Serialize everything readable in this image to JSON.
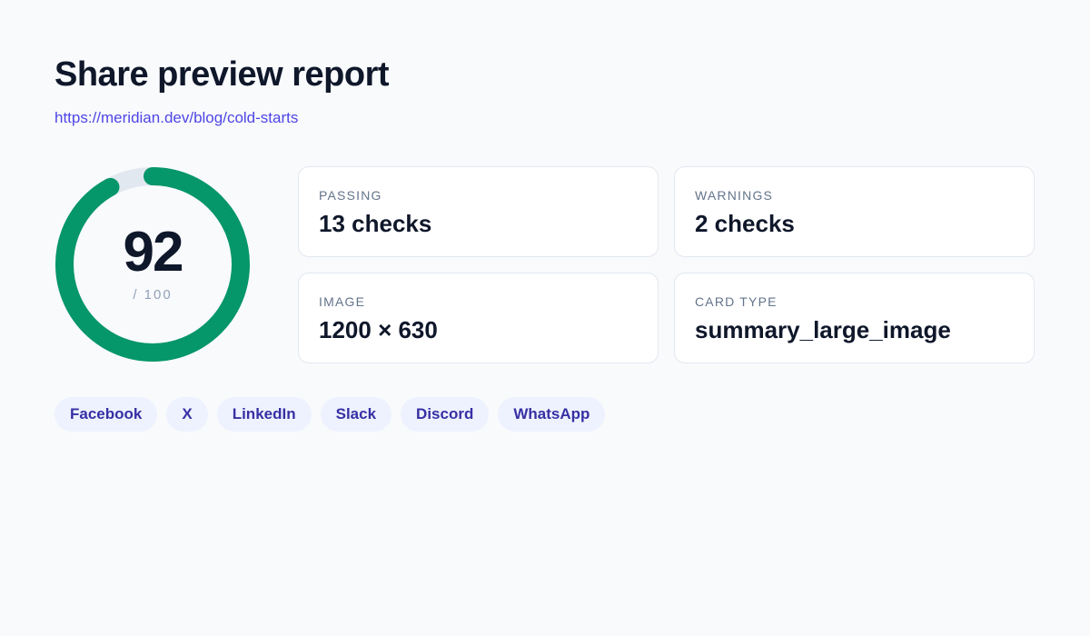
{
  "header": {
    "title": "Share preview report",
    "url": "https://meridian.dev/blog/cold-starts"
  },
  "score": {
    "value": "92",
    "max_label": "/ 100",
    "fraction": 0.92,
    "color": "#059669",
    "track_color": "#e2e8f0"
  },
  "stats": [
    {
      "label": "PASSING",
      "value": "13 checks"
    },
    {
      "label": "WARNINGS",
      "value": "2 checks"
    },
    {
      "label": "IMAGE",
      "value": "1200 × 630"
    },
    {
      "label": "CARD TYPE",
      "value": "summary_large_image"
    }
  ],
  "platforms": [
    "Facebook",
    "X",
    "LinkedIn",
    "Slack",
    "Discord",
    "WhatsApp"
  ],
  "colors": {
    "accent": "#4f46e5",
    "chip_bg": "#eef2ff",
    "chip_text": "#3730a3"
  }
}
